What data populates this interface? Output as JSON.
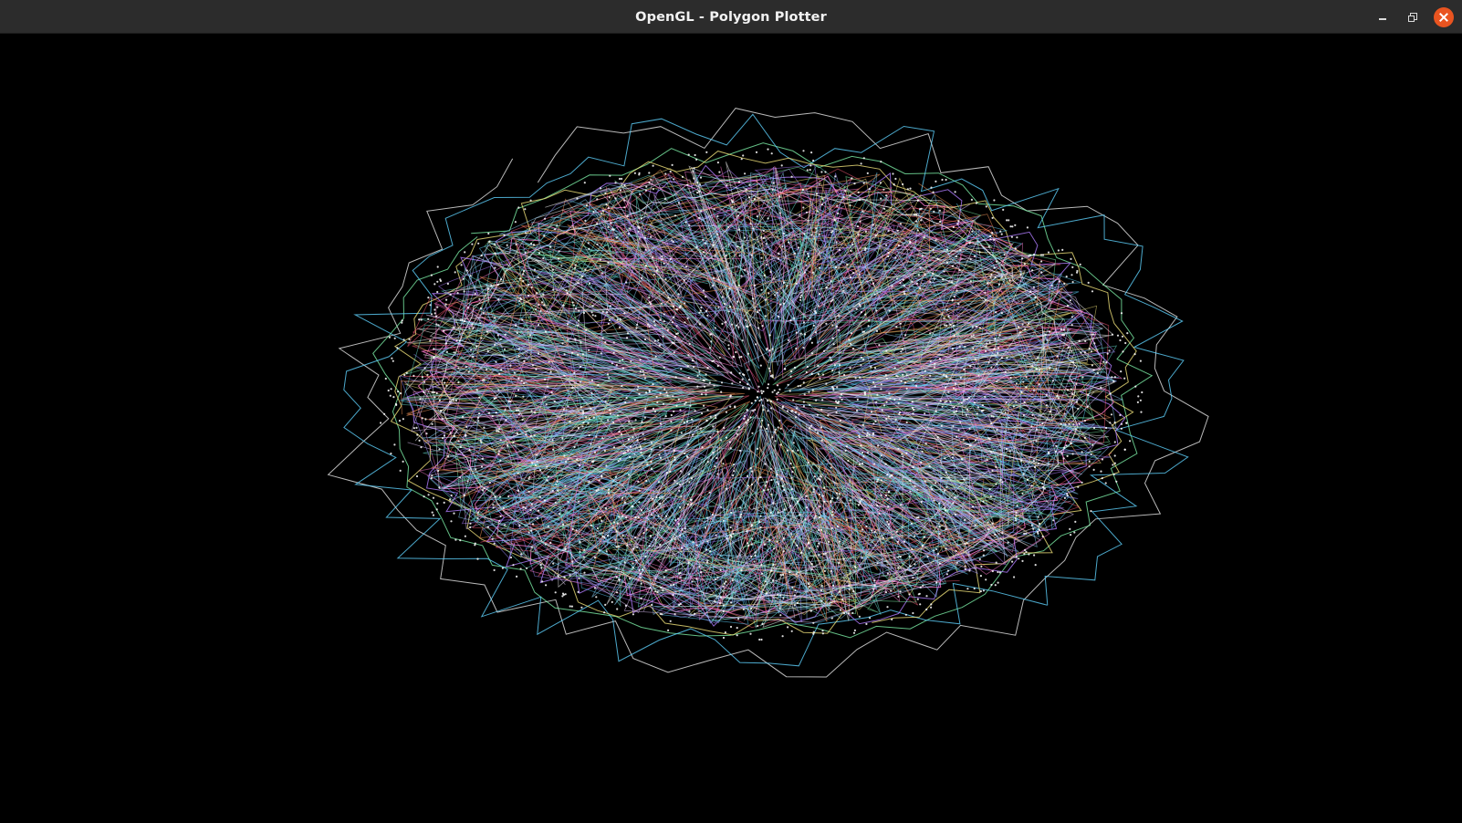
{
  "window": {
    "title": "OpenGL - Polygon Plotter",
    "background": "#000000",
    "titlebar_color": "#2c2c2c",
    "close_button_color": "#e95420"
  },
  "controls": {
    "minimize_icon": "minimize-icon",
    "maximize_icon": "restore-icon",
    "close_icon": "close-icon"
  },
  "plot": {
    "palette": [
      "#ffffff",
      "#9b8cff",
      "#ff7ad1",
      "#7df0a8",
      "#f0e27a",
      "#5fd3ff",
      "#ff9a5c",
      "#b07dff",
      "#66e0d0",
      "#ff5c7a",
      "#e6c8ff",
      "#8fd6ff"
    ]
  }
}
